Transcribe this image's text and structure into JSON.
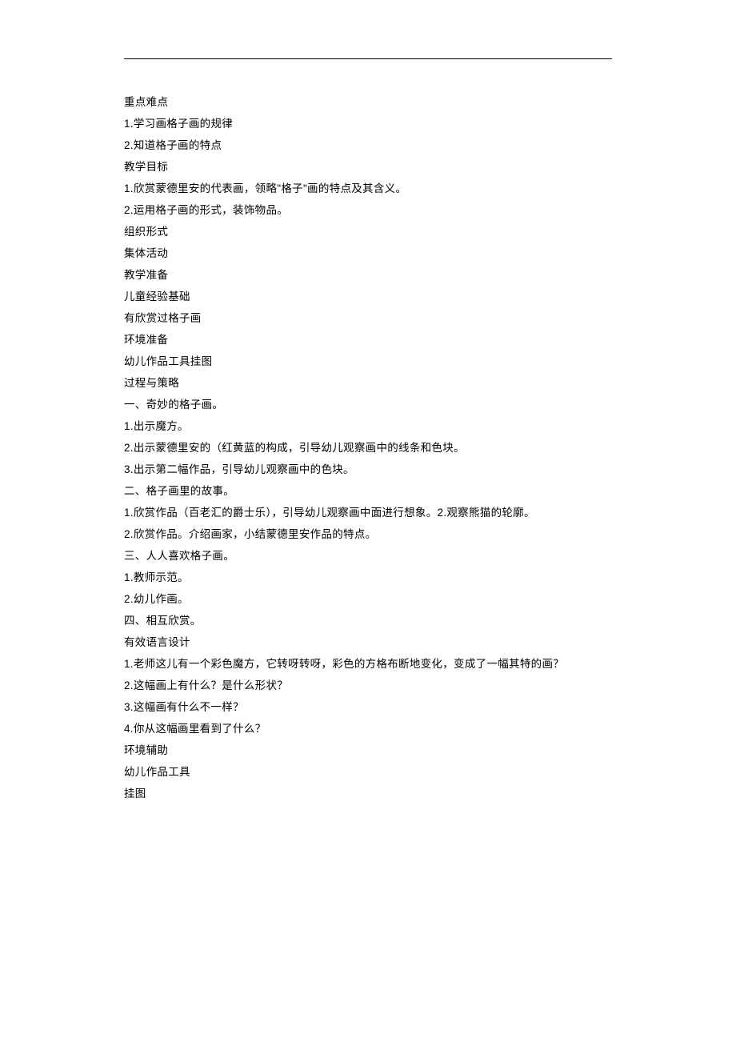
{
  "lines": [
    "重点难点",
    "1.学习画格子画的规律",
    "2.知道格子画的特点",
    "教学目标",
    "1.欣赏蒙德里安的代表画，领略\"格子\"画的特点及其含义。",
    "2.运用格子画的形式，装饰物品。",
    "组织形式",
    "集体活动",
    "教学准备",
    "儿童经验基础",
    "有欣赏过格子画",
    "环境准备",
    "幼儿作品工具挂图",
    "过程与策略",
    "一、奇妙的格子画。",
    "1.出示魔方。",
    "2.出示蒙德里安的（红黄蓝的构成，引导幼儿观察画中的线条和色块。",
    "3.出示第二幅作品，引导幼儿观察画中的色块。",
    "二、格子画里的故事。",
    "1.欣赏作品（百老汇的爵士乐），引导幼儿观察画中面进行想象。2.观察熊猫的轮廓。",
    "2.欣赏作品。介绍画家，小结蒙德里安作品的特点。",
    "三、人人喜欢格子画。",
    "1.教师示范。",
    "2.幼儿作画。",
    "四、相互欣赏。",
    "有效语言设计",
    "1.老师这儿有一个彩色魔方，它转呀转呀，彩色的方格布断地变化，变成了一幅其特的画？",
    "2.这幅画上有什么？是什么形状？",
    "3.这幅画有什么不一样？",
    "4.你从这幅画里看到了什么？",
    "环境辅助",
    "幼儿作品工具",
    "挂图"
  ]
}
